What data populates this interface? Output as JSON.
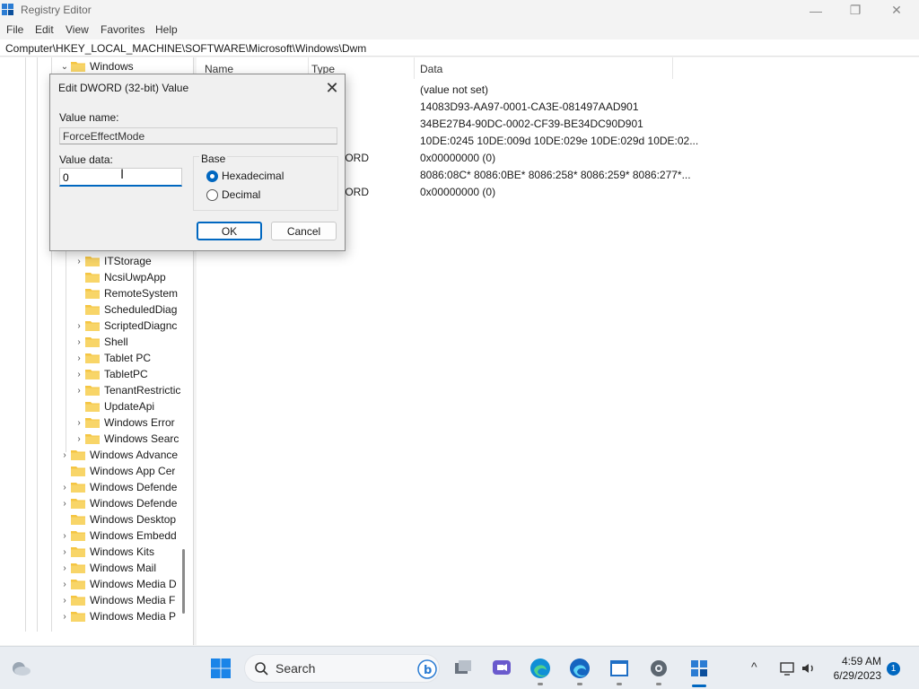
{
  "window": {
    "title": "Registry Editor",
    "controls": {
      "minimize": "—",
      "maximize": "❐",
      "close": "✕"
    }
  },
  "menu": [
    "File",
    "Edit",
    "View",
    "Favorites",
    "Help"
  ],
  "address": "Computer\\HKEY_LOCAL_MACHINE\\SOFTWARE\\Microsoft\\Windows\\Dwm",
  "tree": {
    "top_item": {
      "label": "Windows",
      "expanded": true
    },
    "children": [
      {
        "label": "ITStorage",
        "has_children": true
      },
      {
        "label": "NcsiUwpApp",
        "has_children": false
      },
      {
        "label": "RemoteSystem",
        "has_children": false
      },
      {
        "label": "ScheduledDiag",
        "has_children": false
      },
      {
        "label": "ScriptedDiagnc",
        "has_children": true
      },
      {
        "label": "Shell",
        "has_children": true
      },
      {
        "label": "Tablet PC",
        "has_children": true
      },
      {
        "label": "TabletPC",
        "has_children": true
      },
      {
        "label": "TenantRestrictic",
        "has_children": true
      },
      {
        "label": "UpdateApi",
        "has_children": false
      },
      {
        "label": "Windows Error",
        "has_children": true
      },
      {
        "label": "Windows Searc",
        "has_children": true
      }
    ],
    "siblings": [
      {
        "label": "Windows Advance",
        "has_children": true
      },
      {
        "label": "Windows App Cer",
        "has_children": false
      },
      {
        "label": "Windows Defende",
        "has_children": true
      },
      {
        "label": "Windows Defende",
        "has_children": true
      },
      {
        "label": "Windows Desktop",
        "has_children": false
      },
      {
        "label": "Windows Embedd",
        "has_children": true
      },
      {
        "label": "Windows Kits",
        "has_children": true
      },
      {
        "label": "Windows Mail",
        "has_children": true
      },
      {
        "label": "Windows Media D",
        "has_children": true
      },
      {
        "label": "Windows Media F",
        "has_children": true
      },
      {
        "label": "Windows Media P",
        "has_children": true
      }
    ]
  },
  "values_list": {
    "columns": {
      "name": "Name",
      "type": "Type",
      "data": "Data"
    },
    "rows": [
      {
        "type": "",
        "data": "(value not set)"
      },
      {
        "type": "",
        "data": "14083D93-AA97-0001-CA3E-081497AAD901"
      },
      {
        "type": "",
        "data": "34BE27B4-90DC-0002-CF39-BE34DC90D901"
      },
      {
        "type": "",
        "data": "10DE:0245 10DE:009d 10DE:029e 10DE:029d 10DE:02..."
      },
      {
        "type": "WORD",
        "data": "0x00000000 (0)"
      },
      {
        "type": "",
        "data": "8086:08C* 8086:0BE* 8086:258* 8086:259* 8086:277*..."
      },
      {
        "type": "WORD",
        "data": "0x00000000 (0)"
      }
    ]
  },
  "dialog": {
    "title": "Edit DWORD (32-bit) Value",
    "close": "✕",
    "value_name_label": "Value name:",
    "value_name": "ForceEffectMode",
    "value_data_label": "Value data:",
    "value_data": "0",
    "base_label": "Base",
    "base_options": [
      "Hexadecimal",
      "Decimal"
    ],
    "base_selected": "Hexadecimal",
    "ok": "OK",
    "cancel": "Cancel"
  },
  "taskbar": {
    "search_placeholder": "Search",
    "icons": [
      "weather-icon",
      "start-icon",
      "search-icon",
      "bing-icon",
      "task-view-icon",
      "chat-icon",
      "edge-icon",
      "edge-beta-icon",
      "notepad-icon",
      "settings-icon",
      "regedit-icon"
    ],
    "tray": {
      "chevron": "^"
    },
    "time": "4:59 AM",
    "date": "6/29/2023",
    "notification_count": "1"
  },
  "colors": {
    "accent": "#0067c0",
    "folder": "#f5c542"
  }
}
